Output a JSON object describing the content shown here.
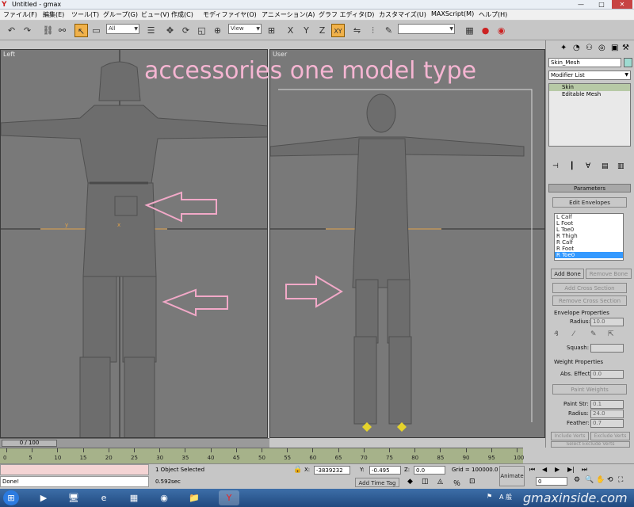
{
  "window": {
    "title": "Untitled - gmax"
  },
  "menu": [
    "ファイル(F)",
    "編集(E)",
    "ツール(T)",
    "グループ(G)",
    "ビュー(V)",
    "作成(C)",
    "モディファイヤ(O)",
    "アニメーション(A)",
    "グラフ エディタ(D)",
    "カスタマイズ(U)",
    "MAXScript(M)",
    "ヘルプ(H)"
  ],
  "toolbar": {
    "selection_filter": "All",
    "ref_coord": "View",
    "axis_x": "X",
    "axis_y": "Y",
    "axis_z": "Z",
    "axis_xy": "XY"
  },
  "viewports": {
    "left": {
      "label": "Left",
      "frame_counter": "0 / 100"
    },
    "user": {
      "label": "User"
    }
  },
  "overlay": {
    "title": "accessories one model type"
  },
  "command_panel": {
    "object_name": "Skin_Mesh",
    "modifier_list": "Modifier List",
    "stack": [
      "Skin",
      "Editable Mesh"
    ],
    "parameters_title": "Parameters",
    "edit_envelopes": "Edit Envelopes",
    "bones": [
      "L Calf",
      "L Foot",
      "L Toe0",
      "R Thigh",
      "R Calf",
      "R Foot",
      "R Toe0"
    ],
    "selected_bone": "R Toe0",
    "add_bone": "Add Bone",
    "remove_bone": "Remove Bone",
    "add_cross_section": "Add Cross Section",
    "remove_cross_section": "Remove Cross Section",
    "envelope_properties": "Envelope Properties",
    "radius_label": "Radius:",
    "radius_value": "10.0",
    "squash_label": "Squash:",
    "weight_properties": "Weight Properties",
    "abs_effect_label": "Abs. Effect:",
    "abs_effect_value": "0.0",
    "paint_weights": "Paint Weights",
    "paint_str_label": "Paint Str:",
    "paint_str_value": "0.1",
    "paint_radius_label": "Radius:",
    "paint_radius_value": "24.0",
    "feather_label": "Feather:",
    "feather_value": "0.7",
    "include_verts": "Include Verts",
    "exclude_verts": "Exclude Verts",
    "select_excluded": "Select Exclude Verts"
  },
  "timeline": {
    "ticks": [
      "0",
      "5",
      "10",
      "15",
      "20",
      "25",
      "30",
      "35",
      "40",
      "45",
      "50",
      "55",
      "60",
      "65",
      "70",
      "75",
      "80",
      "85",
      "90",
      "95",
      "100"
    ]
  },
  "status": {
    "selected": "1 Object Selected",
    "prompt": "Done!",
    "time": "0.592sec",
    "x_label": "X:",
    "x_value": "-3839232",
    "y_label": "Y:",
    "y_value": "-0.495",
    "z_label": "Z:",
    "z_value": "0.0",
    "grid": "Grid = 100000.0",
    "add_time_tag": "Add Time Tag",
    "animate": "Animate",
    "frame_value": "0"
  },
  "taskbar": {
    "tray_text": "A 般",
    "watermark": "gmaxinside.com"
  },
  "colors": {
    "accent": "#f0b14a",
    "overlay": "#f5b5d2",
    "viewport": "#797979",
    "arrow": "#f2a9c8"
  }
}
